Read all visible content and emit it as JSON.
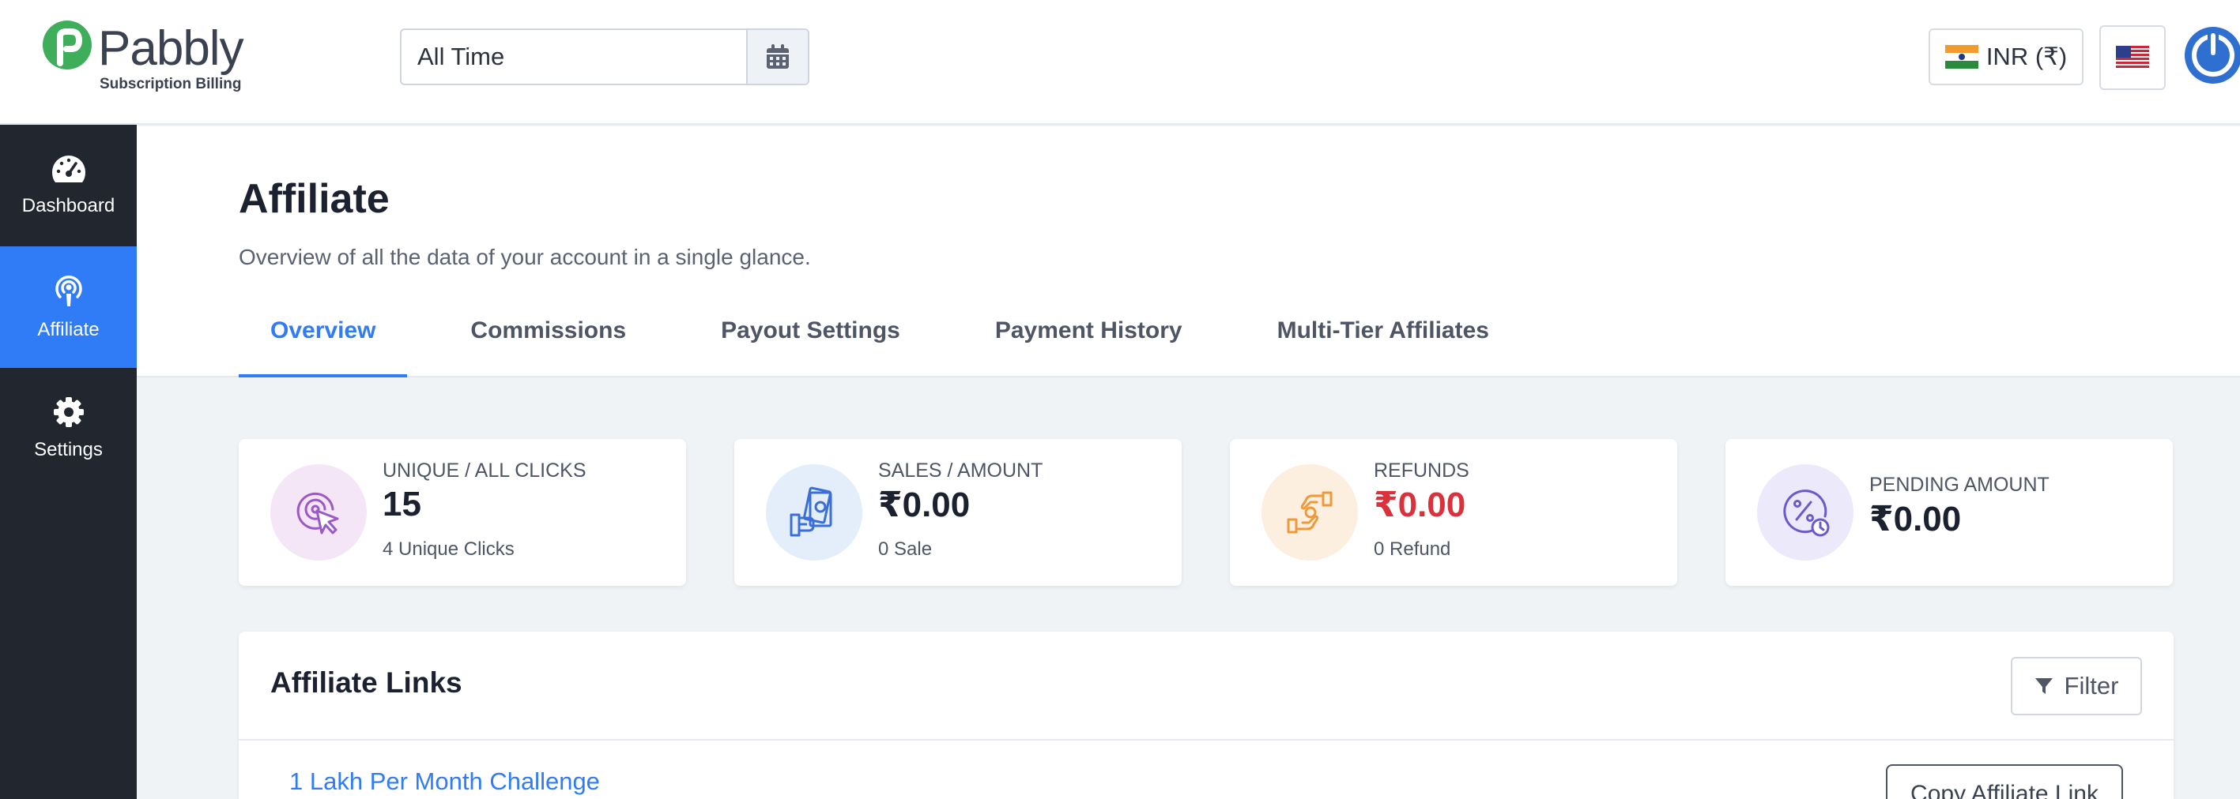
{
  "brand": {
    "name": "Pabbly",
    "subtitle": "Subscription Billing",
    "color": "#3fae5a"
  },
  "header": {
    "date_range_value": "All Time",
    "currency_label": "INR (₹)",
    "language_flag": "us-flag-icon"
  },
  "sidebar": {
    "items": [
      {
        "label": "Dashboard",
        "icon": "speedometer-icon",
        "active": false
      },
      {
        "label": "Affiliate",
        "icon": "broadcast-icon",
        "active": true
      },
      {
        "label": "Settings",
        "icon": "gear-icon",
        "active": false
      }
    ]
  },
  "page": {
    "title": "Affiliate",
    "subtitle": "Overview of all the data of your account in a single glance.",
    "tabs": [
      {
        "label": "Overview",
        "active": true
      },
      {
        "label": "Commissions",
        "active": false
      },
      {
        "label": "Payout Settings",
        "active": false
      },
      {
        "label": "Payment History",
        "active": false
      },
      {
        "label": "Multi-Tier Affiliates",
        "active": false
      }
    ]
  },
  "stats": [
    {
      "label": "UNIQUE / ALL CLICKS",
      "value": "15",
      "foot": "4 Unique Clicks",
      "icon": "click-target-icon",
      "color": "#9b59c6",
      "bg": "#f4e6f7"
    },
    {
      "label": "SALES / AMOUNT",
      "value": "₹0.00",
      "foot": "0 Sale",
      "icon": "cash-hand-icon",
      "color": "#3b6fd8",
      "bg": "#e4eefb"
    },
    {
      "label": "REFUNDS",
      "value": "₹0.00",
      "foot": "0 Refund",
      "icon": "refund-hands-icon",
      "color": "#ef9a3a",
      "bg": "#fdefdf",
      "value_color": "#d9323c"
    },
    {
      "label": "PENDING AMOUNT",
      "value": "₹0.00",
      "foot": "",
      "icon": "percent-clock-icon",
      "color": "#6a5acd",
      "bg": "#ece9fb"
    }
  ],
  "affiliate_links": {
    "title": "Affiliate Links",
    "filter_label": "Filter",
    "rows": [
      {
        "name": "1 Lakh Per Month Challenge",
        "copy_label": "Copy Affiliate Link"
      }
    ]
  },
  "colors": {
    "accent": "#2f7cf6",
    "sidebar_bg": "#22262e",
    "refund_red": "#d9323c"
  }
}
